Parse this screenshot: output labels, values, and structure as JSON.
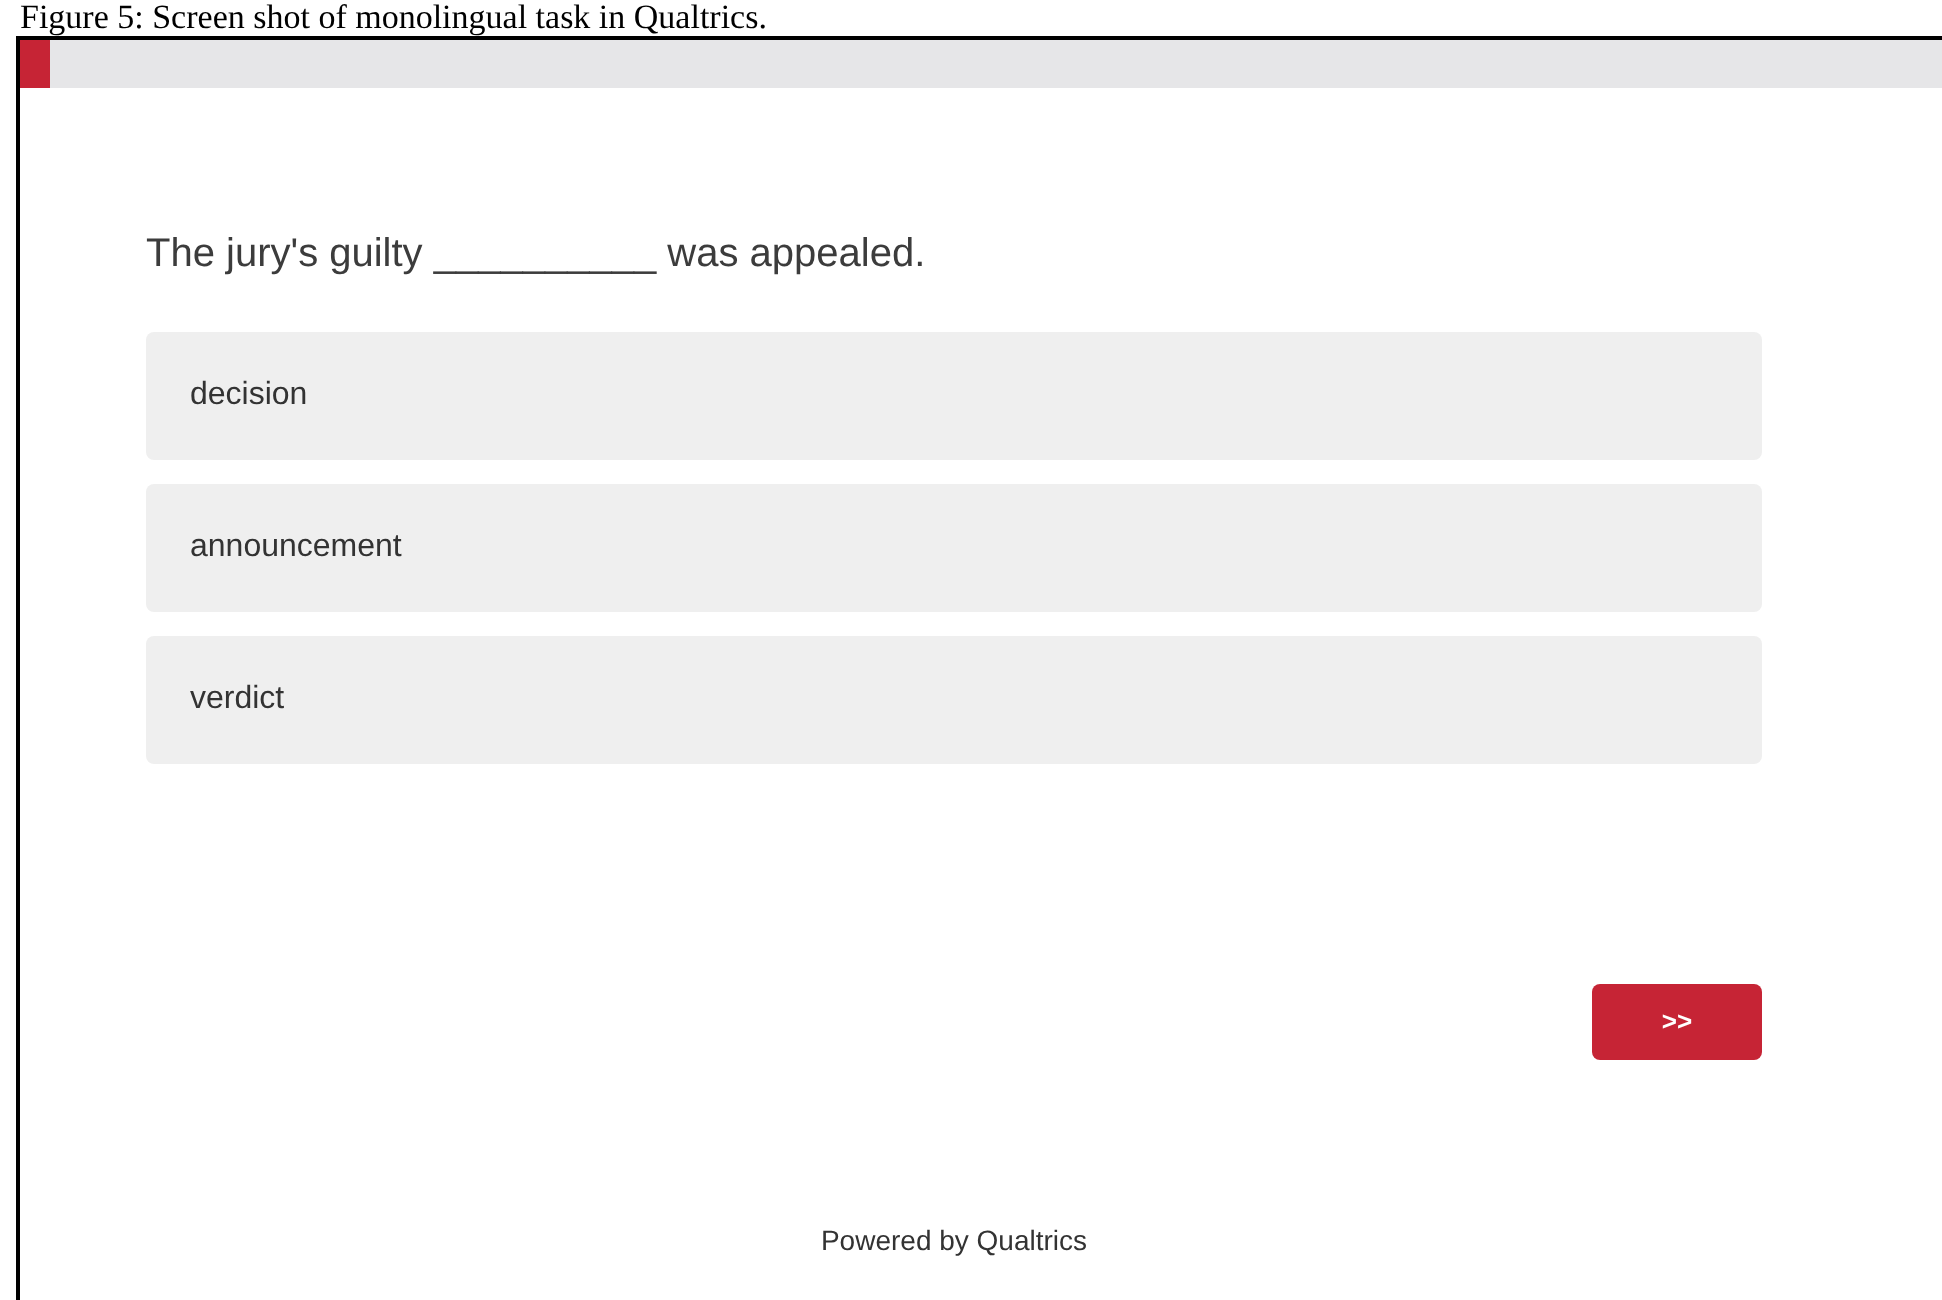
{
  "caption": "Figure 5: Screen shot of monolingual task in Qualtrics.",
  "progress": {
    "level": 0.016
  },
  "question": "The jury's guilty __________ was appealed.",
  "choices": [
    {
      "label": "decision",
      "selected": false
    },
    {
      "label": "announcement",
      "selected": false
    },
    {
      "label": "verdict",
      "selected": false
    }
  ],
  "next_button": ">>",
  "footer": "Powered by Qualtrics"
}
